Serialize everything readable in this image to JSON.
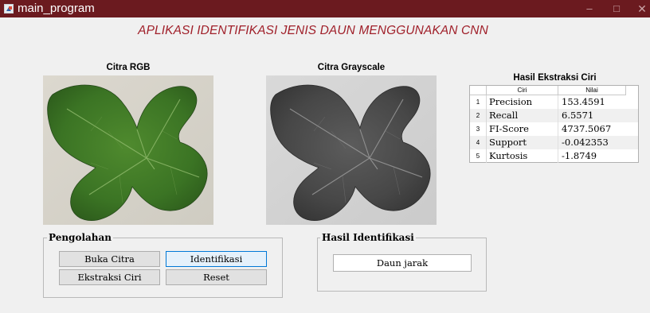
{
  "window": {
    "title": "main_program",
    "controls": {
      "minimize": "–",
      "maximize": "□",
      "close": "✕"
    }
  },
  "heading": "APLIKASI IDENTIFIKASI JENIS DAUN MENGGUNAKAN CNN",
  "axes": {
    "rgb_title": "Citra RGB",
    "gray_title": "Citra Grayscale"
  },
  "features": {
    "title": "Hasil Ekstraksi Ciri",
    "columns": [
      "Ciri",
      "Nilai"
    ],
    "rows": [
      {
        "index": "1",
        "name": "Precision",
        "value": "153.4591"
      },
      {
        "index": "2",
        "name": "Recall",
        "value": "6.5571"
      },
      {
        "index": "3",
        "name": "FI-Score",
        "value": "4737.5067"
      },
      {
        "index": "4",
        "name": "Support",
        "value": "-0.042353"
      },
      {
        "index": "5",
        "name": "Kurtosis",
        "value": "-1.8749"
      }
    ]
  },
  "processing": {
    "label": "Pengolahan",
    "buttons": {
      "open": "Buka Citra",
      "identify": "Identifikasi",
      "extract": "Ekstraksi Ciri",
      "reset": "Reset"
    }
  },
  "identification": {
    "label": "Hasil Identifikasi",
    "result": "Daun jarak"
  },
  "colors": {
    "titlebar": "#6b1a1f",
    "heading": "#a0202a",
    "leaf_green": "#3f7a26",
    "leaf_gray": "#4d4d4d",
    "button_focus": "#0078d7"
  }
}
